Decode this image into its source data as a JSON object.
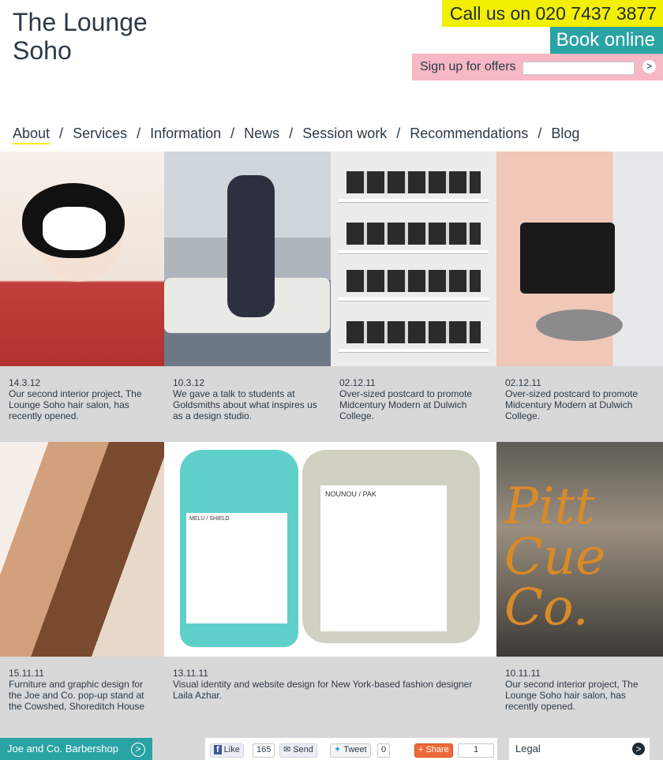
{
  "header": {
    "logo_line1": "The Lounge",
    "logo_line2": "Soho",
    "call_us": "Call us on 020 7437 3877",
    "book_online": "Book online",
    "signup_label": "Sign up for offers",
    "signup_go": ">"
  },
  "nav": {
    "items": [
      "About",
      "Services",
      "Information",
      "News",
      "Session work",
      "Recommendations",
      "Blog"
    ],
    "separator": "/"
  },
  "posts": [
    {
      "date": "14.3.12",
      "text": "Our second interior project, The Lounge Soho hair salon, has recently opened."
    },
    {
      "date": "10.3.12",
      "text": "We gave a talk to students at Goldsmiths about what inspires us as a design studio."
    },
    {
      "date": "02.12.11",
      "text": "Over-sized postcard to promote Midcentury Modern at Dulwich College."
    },
    {
      "date": "02.12.11",
      "text": "Over-sized postcard to promote Midcentury Modern at Dulwich College."
    },
    {
      "date": "15.11.11",
      "text": "Furniture and graphic design for the Joe and Co. pop-up stand at the Cowshed, Shoreditch House"
    },
    {
      "date": "13.11.11",
      "text": "Visual identity and website design for New York-based fashion designer Laila Azhar."
    },
    {
      "date": "10.11.11",
      "text": "Our second interior project, The Lounge Soho hair salon, has recently opened."
    }
  ],
  "image_text": {
    "bottle_label": "MELU / SHIELD",
    "jar_label": "NOUNOU / PAK",
    "sign_text": "Pitt Cue Co."
  },
  "footer": {
    "joe_label": "Joe and Co. Barbershop",
    "arrow": ">",
    "like_label": "Like",
    "like_count": "165",
    "send_label": "Send",
    "tweet_label": "Tweet",
    "tweet_count": "0",
    "share_label": "Share",
    "share_count": "1",
    "legal_label": "Legal"
  },
  "colors": {
    "yellow": "#f2f000",
    "teal": "#2aa3a4",
    "pink": "#f5b8c4",
    "caption_bg": "#d8d8d8"
  }
}
